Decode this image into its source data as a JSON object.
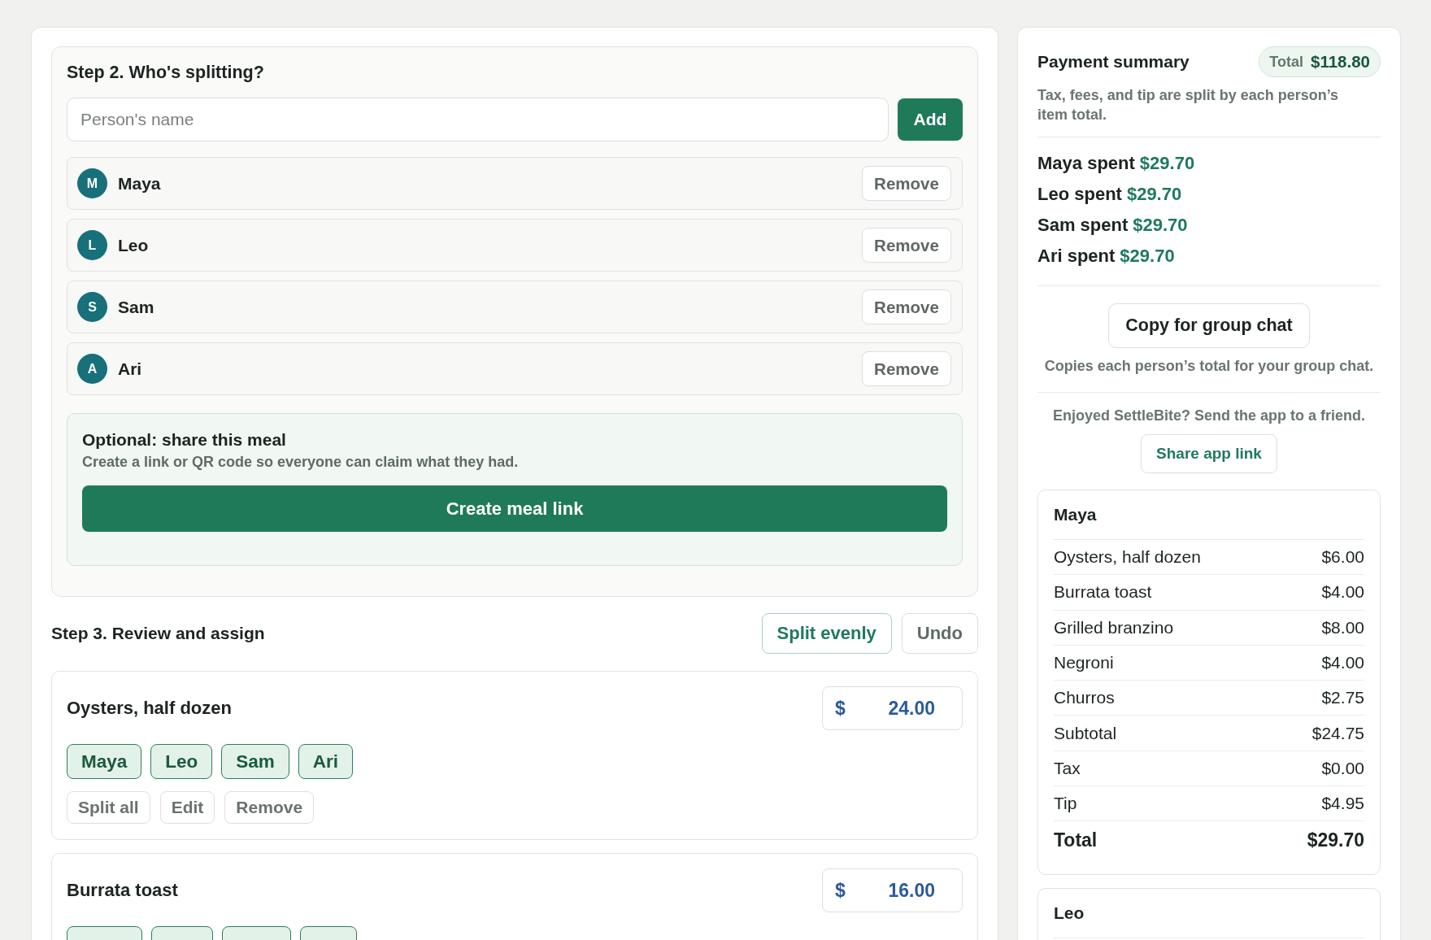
{
  "step2": {
    "title": "Step 2. Who's splitting?",
    "name_field": {
      "placeholder": "Person's name"
    },
    "add_button": "Add",
    "people": [
      {
        "initial": "M",
        "name": "Maya",
        "remove_button": "Remove"
      },
      {
        "initial": "L",
        "name": "Leo",
        "remove_button": "Remove"
      },
      {
        "initial": "S",
        "name": "Sam",
        "remove_button": "Remove"
      },
      {
        "initial": "A",
        "name": "Ari",
        "remove_button": "Remove"
      }
    ]
  },
  "share_meal": {
    "title": "Optional: share this meal",
    "description": "Create a link or QR code so everyone can claim what they had.",
    "button": "Create meal link"
  },
  "step3": {
    "title": "Step 3. Review and assign",
    "buttons": [
      {
        "label": "Split evenly",
        "kind": "primary"
      },
      {
        "label": "Undo",
        "kind": "secondary"
      }
    ],
    "items": [
      {
        "name": "Oysters, half dozen",
        "currency": "$",
        "price": "24.00",
        "assignees": [
          {
            "label": "Maya",
            "selected": true
          },
          {
            "label": "Leo",
            "selected": true
          },
          {
            "label": "Sam",
            "selected": true
          },
          {
            "label": "Ari",
            "selected": true
          }
        ],
        "actions": [
          "Split all",
          "Edit",
          "Remove"
        ]
      },
      {
        "name": "Burrata toast",
        "currency": "$",
        "price": "16.00",
        "assignees": [
          {
            "selected": true
          },
          {
            "selected": true
          },
          {
            "selected": true
          },
          {
            "selected": true
          }
        ]
      }
    ]
  },
  "summary": {
    "title": "Payment summary",
    "total_label": "Total",
    "total_value": "$118.80",
    "note": "Tax, fees, and tip are split by each person’s item total.",
    "spent": [
      {
        "label": "Maya spent",
        "amount": "$29.70"
      },
      {
        "label": "Leo spent",
        "amount": "$29.70"
      },
      {
        "label": "Sam spent",
        "amount": "$29.70"
      },
      {
        "label": "Ari spent",
        "amount": "$29.70"
      }
    ],
    "copy_button": "Copy for group chat",
    "copy_note": "Copies each person’s total for your group chat.",
    "share_note": "Enjoyed SettleBite? Send the app to a friend.",
    "share_button": "Share app link",
    "breakdowns": [
      {
        "name": "Maya",
        "rows": [
          {
            "label": "Oysters, half dozen",
            "amount": "$6.00",
            "kind": "line"
          },
          {
            "label": "Burrata toast",
            "amount": "$4.00",
            "kind": "line"
          },
          {
            "label": "Grilled branzino",
            "amount": "$8.00",
            "kind": "line"
          },
          {
            "label": "Negroni",
            "amount": "$4.00",
            "kind": "line"
          },
          {
            "label": "Churros",
            "amount": "$2.75",
            "kind": "line"
          },
          {
            "label": "Subtotal",
            "amount": "$24.75",
            "kind": "line"
          },
          {
            "label": "Tax",
            "amount": "$0.00",
            "kind": "line"
          },
          {
            "label": "Tip",
            "amount": "$4.95",
            "kind": "line"
          },
          {
            "label": "Total",
            "amount": "$29.70",
            "kind": "total"
          }
        ]
      },
      {
        "name": "Leo"
      }
    ]
  }
}
